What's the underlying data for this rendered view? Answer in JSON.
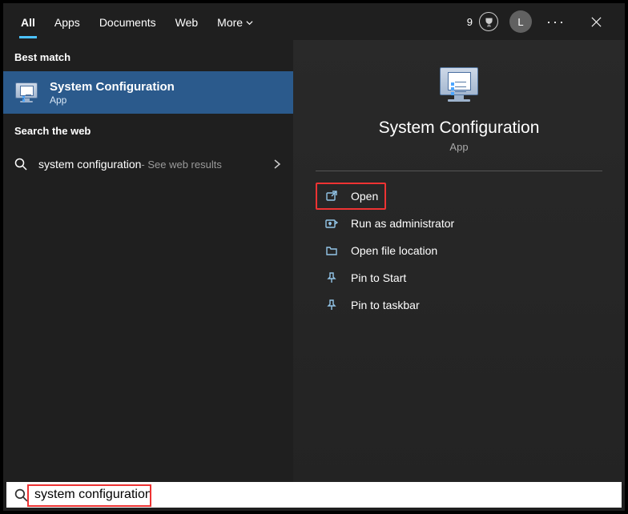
{
  "topbar": {
    "tabs": [
      "All",
      "Apps",
      "Documents",
      "Web",
      "More"
    ],
    "active_tab": 0,
    "points": "9",
    "avatar_letter": "L"
  },
  "left": {
    "best_match_label": "Best match",
    "best_match": {
      "title": "System Configuration",
      "subtitle": "App"
    },
    "search_web_label": "Search the web",
    "web_result": {
      "term": "system configuration",
      "suffix": " - See web results"
    }
  },
  "right": {
    "title": "System Configuration",
    "subtitle": "App",
    "actions": [
      {
        "key": "open",
        "label": "Open",
        "highlight": true
      },
      {
        "key": "runas",
        "label": "Run as administrator",
        "highlight": false
      },
      {
        "key": "openloc",
        "label": "Open file location",
        "highlight": false
      },
      {
        "key": "pinstart",
        "label": "Pin to Start",
        "highlight": false
      },
      {
        "key": "pintask",
        "label": "Pin to taskbar",
        "highlight": false
      }
    ]
  },
  "search": {
    "value": "system configuration"
  }
}
